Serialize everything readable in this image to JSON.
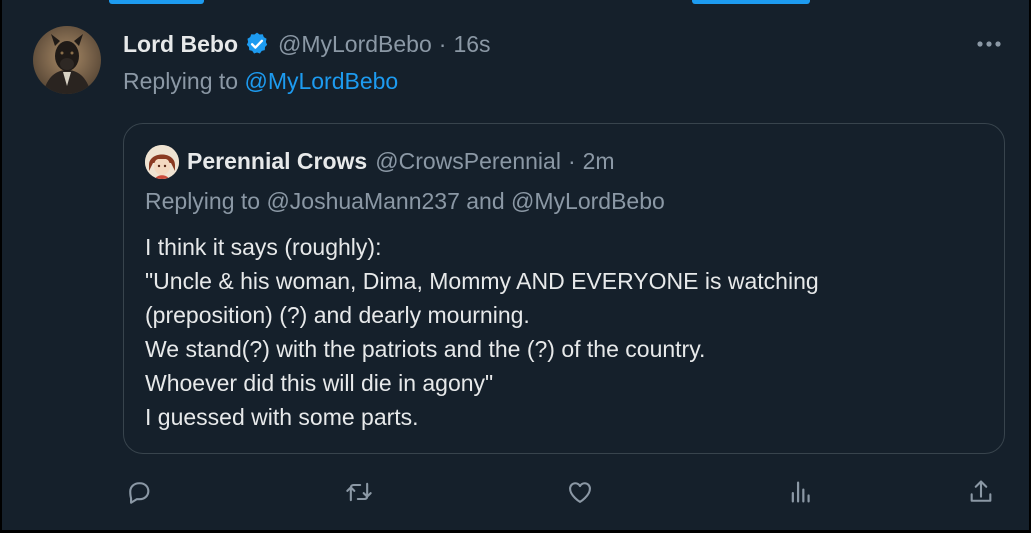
{
  "colors": {
    "background": "#15202b",
    "primary_text": "#e7e9ea",
    "secondary_text": "#8b98a5",
    "accent": "#1d9bf0",
    "border": "#38444d"
  },
  "reply": {
    "author_name": "Lord Bebo",
    "verified": true,
    "author_handle": "@MyLordBebo",
    "separator": "·",
    "timestamp": "16s",
    "replying_prefix": "Replying to",
    "replying_to": "@MyLordBebo",
    "more_icon": "more-horizontal-icon"
  },
  "quoted_tweet": {
    "author_name": "Perennial Crows",
    "author_handle": "@CrowsPerennial",
    "separator": "·",
    "timestamp": "2m",
    "replying_text": "Replying to @JoshuaMann237 and @MyLordBebo",
    "body_lines": [
      "I think it says (roughly):",
      "\"Uncle & his woman, Dima, Mommy AND EVERYONE is watching",
      "(preposition) (?) and dearly mourning.",
      "We stand(?) with the patriots and the (?) of the country.",
      "Whoever did this will die in agony\"",
      "I guessed with some parts."
    ]
  },
  "actions": [
    {
      "name": "reply",
      "icon": "reply-icon"
    },
    {
      "name": "retweet",
      "icon": "retweet-icon"
    },
    {
      "name": "like",
      "icon": "heart-icon"
    },
    {
      "name": "views",
      "icon": "views-icon"
    },
    {
      "name": "share",
      "icon": "share-icon"
    }
  ]
}
